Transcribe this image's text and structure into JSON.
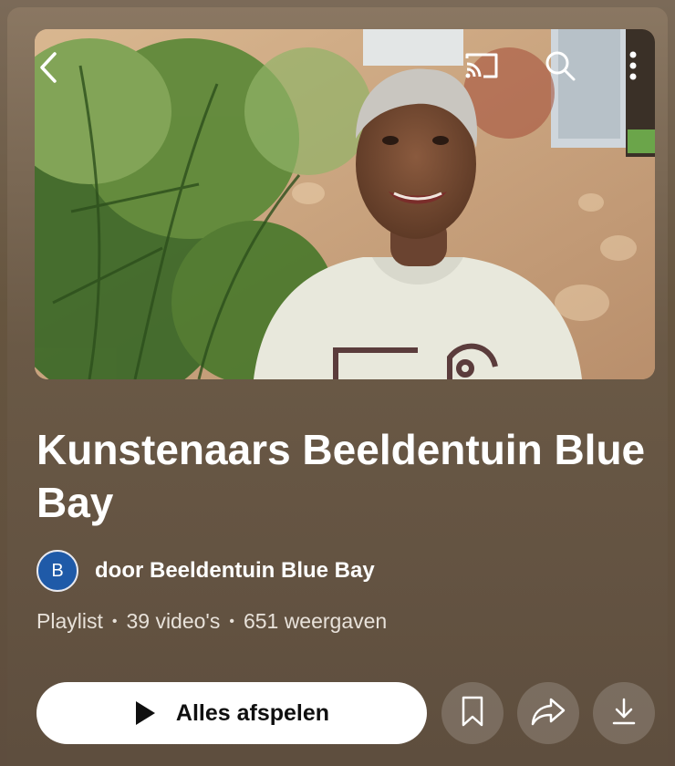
{
  "playlist": {
    "title": "Kunstenaars Beeldentuin Blue Bay",
    "channel_initial": "B",
    "channel_label": "door Beeldentuin Blue Bay",
    "type": "Playlist",
    "video_count": "39 video's",
    "views": "651 weergaven",
    "separator": "•"
  },
  "actions": {
    "play_all_label": "Alles afspelen"
  },
  "icons": {
    "back": "chevron-left-icon",
    "cast": "cast-icon",
    "search": "search-icon",
    "more": "more-vertical-icon",
    "play": "play-icon",
    "save": "bookmark-icon",
    "share": "share-arrow-icon",
    "download": "download-icon"
  },
  "colors": {
    "background": "#5f4f40",
    "avatar": "#1f5aa8",
    "play_button_bg": "#ffffff",
    "text": "#ffffff"
  }
}
